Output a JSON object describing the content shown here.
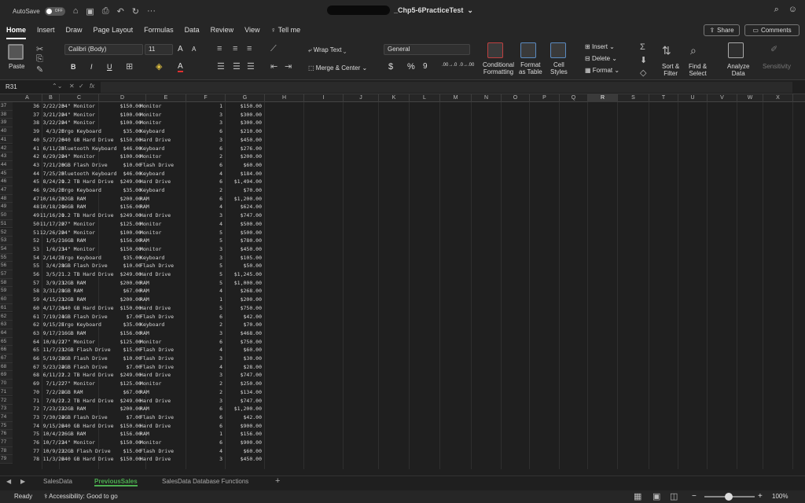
{
  "titlebar": {
    "autosave_label": "AutoSave",
    "autosave_state": "OFF",
    "doc_title": "_Chp5-6PracticeTest",
    "more_label": "···"
  },
  "menu": [
    "Home",
    "Insert",
    "Draw",
    "Page Layout",
    "Formulas",
    "Data",
    "Review",
    "View",
    "Tell me"
  ],
  "share_label": "Share",
  "comments_label": "Comments",
  "ribbon": {
    "paste": "Paste",
    "font_name": "Calibri (Body)",
    "font_size": "11",
    "bold": "B",
    "italic": "I",
    "underline": "U",
    "font_grow": "A",
    "font_shrink": "A",
    "font_color": "A",
    "wrap_text": "Wrap Text",
    "merge_center": "Merge & Center",
    "number_format": "General",
    "currency": "$",
    "percent": "%",
    "comma": "9",
    "inc_decimal": ".00→.0",
    "dec_decimal": ".0→.00",
    "conditional_formatting": "Conditional\nFormatting",
    "conditional_1": "Conditional",
    "conditional_2": "Formatting",
    "format_table_1": "Format",
    "format_table_2": "as Table",
    "cell_styles_1": "Cell",
    "cell_styles_2": "Styles",
    "insert": "Insert",
    "delete": "Delete",
    "format": "Format",
    "sort_filter_1": "Sort &",
    "sort_filter_2": "Filter",
    "find_select_1": "Find &",
    "find_select_2": "Select",
    "analyze_1": "Analyze",
    "analyze_2": "Data",
    "sensitivity": "Sensitivity"
  },
  "namebox": "R31",
  "fx": "fx",
  "columns": [
    "A",
    "B",
    "C",
    "D",
    "E",
    "F",
    "G",
    "H",
    "I",
    "J",
    "K",
    "L",
    "M",
    "N",
    "O",
    "P",
    "Q",
    "R",
    "S",
    "T",
    "U",
    "V",
    "W",
    "X"
  ],
  "selected_column": "R",
  "rows": [
    {
      "n": "37",
      "a": "36",
      "b": "2/22/20",
      "c": "34\" Monitor",
      "d": "$150.00",
      "e": "Monitor",
      "f": "1",
      "g": "$150.00"
    },
    {
      "n": "38",
      "a": "37",
      "b": "3/21/20",
      "c": "24\" Monitor",
      "d": "$100.00",
      "e": "Monitor",
      "f": "3",
      "g": "$300.00"
    },
    {
      "n": "39",
      "a": "38",
      "b": "3/22/20",
      "c": "24\" Monitor",
      "d": "$100.00",
      "e": "Monitor",
      "f": "3",
      "g": "$300.00"
    },
    {
      "n": "40",
      "a": "39",
      "b": "4/3/20",
      "c": "Ergo Keyboard",
      "d": "$35.00",
      "e": "Keyboard",
      "f": "6",
      "g": "$210.00"
    },
    {
      "n": "41",
      "a": "40",
      "b": "5/27/20",
      "c": "640 GB Hard Drive",
      "d": "$150.00",
      "e": "Hard Drive",
      "f": "3",
      "g": "$450.00"
    },
    {
      "n": "42",
      "a": "41",
      "b": "6/11/20",
      "c": "Bluetooth Keyboard",
      "d": "$46.00",
      "e": "Keyboard",
      "f": "6",
      "g": "$276.00"
    },
    {
      "n": "43",
      "a": "42",
      "b": "6/29/20",
      "c": "24\" Monitor",
      "d": "$100.00",
      "e": "Monitor",
      "f": "2",
      "g": "$200.00"
    },
    {
      "n": "44",
      "a": "43",
      "b": "7/21/20",
      "c": "8GB Flash Drive",
      "d": "$10.00",
      "e": "Flash Drive",
      "f": "6",
      "g": "$60.00"
    },
    {
      "n": "45",
      "a": "44",
      "b": "7/25/20",
      "c": "Bluetooth Keyboard",
      "d": "$46.00",
      "e": "Keyboard",
      "f": "4",
      "g": "$184.00"
    },
    {
      "n": "46",
      "a": "45",
      "b": "8/24/20",
      "c": "1.2 TB Hard Drive",
      "d": "$249.00",
      "e": "Hard Drive",
      "f": "6",
      "g": "$1,494.00"
    },
    {
      "n": "47",
      "a": "46",
      "b": "9/26/20",
      "c": "Ergo Keyboard",
      "d": "$35.00",
      "e": "Keyboard",
      "f": "2",
      "g": "$70.00"
    },
    {
      "n": "48",
      "a": "47",
      "b": "10/16/20",
      "c": "32GB RAM",
      "d": "$200.00",
      "e": "RAM",
      "f": "6",
      "g": "$1,200.00"
    },
    {
      "n": "49",
      "a": "48",
      "b": "10/18/20",
      "c": "16GB RAM",
      "d": "$156.00",
      "e": "RAM",
      "f": "4",
      "g": "$624.00"
    },
    {
      "n": "50",
      "a": "49",
      "b": "11/16/20",
      "c": "1.2 TB Hard Drive",
      "d": "$249.00",
      "e": "Hard Drive",
      "f": "3",
      "g": "$747.00"
    },
    {
      "n": "51",
      "a": "50",
      "b": "11/17/20",
      "c": "27\" Monitor",
      "d": "$125.00",
      "e": "Monitor",
      "f": "4",
      "g": "$500.00"
    },
    {
      "n": "52",
      "a": "51",
      "b": "12/26/20",
      "c": "24\" Monitor",
      "d": "$100.00",
      "e": "Monitor",
      "f": "5",
      "g": "$500.00"
    },
    {
      "n": "53",
      "a": "52",
      "b": "1/5/21",
      "c": "16GB RAM",
      "d": "$156.00",
      "e": "RAM",
      "f": "5",
      "g": "$780.00"
    },
    {
      "n": "54",
      "a": "53",
      "b": "1/6/21",
      "c": "34\" Monitor",
      "d": "$150.00",
      "e": "Monitor",
      "f": "3",
      "g": "$450.00"
    },
    {
      "n": "55",
      "a": "54",
      "b": "2/14/21",
      "c": "Ergo Keyboard",
      "d": "$35.00",
      "e": "Keyboard",
      "f": "3",
      "g": "$105.00"
    },
    {
      "n": "56",
      "a": "55",
      "b": "3/4/21",
      "c": "8GB Flash Drive",
      "d": "$10.00",
      "e": "Flash Drive",
      "f": "5",
      "g": "$50.00"
    },
    {
      "n": "57",
      "a": "56",
      "b": "3/5/21",
      "c": "1.2 TB Hard Drive",
      "d": "$249.00",
      "e": "Hard Drive",
      "f": "5",
      "g": "$1,245.00"
    },
    {
      "n": "58",
      "a": "57",
      "b": "3/9/21",
      "c": "32GB RAM",
      "d": "$200.00",
      "e": "RAM",
      "f": "5",
      "g": "$1,000.00"
    },
    {
      "n": "59",
      "a": "58",
      "b": "3/31/21",
      "c": "8GB RAM",
      "d": "$67.00",
      "e": "RAM",
      "f": "4",
      "g": "$268.00"
    },
    {
      "n": "60",
      "a": "59",
      "b": "4/15/21",
      "c": "32GB RAM",
      "d": "$200.00",
      "e": "RAM",
      "f": "1",
      "g": "$200.00"
    },
    {
      "n": "61",
      "a": "60",
      "b": "4/17/21",
      "c": "640 GB Hard Drive",
      "d": "$150.00",
      "e": "Hard Drive",
      "f": "5",
      "g": "$750.00"
    },
    {
      "n": "62",
      "a": "61",
      "b": "7/19/21",
      "c": "4GB Flash Drive",
      "d": "$7.00",
      "e": "Flash Drive",
      "f": "6",
      "g": "$42.00"
    },
    {
      "n": "63",
      "a": "62",
      "b": "9/15/21",
      "c": "Ergo Keyboard",
      "d": "$35.00",
      "e": "Keyboard",
      "f": "2",
      "g": "$70.00"
    },
    {
      "n": "64",
      "a": "63",
      "b": "9/17/21",
      "c": "16GB RAM",
      "d": "$156.00",
      "e": "RAM",
      "f": "3",
      "g": "$468.00"
    },
    {
      "n": "65",
      "a": "64",
      "b": "10/8/21",
      "c": "27\" Monitor",
      "d": "$125.00",
      "e": "Monitor",
      "f": "6",
      "g": "$750.00"
    },
    {
      "n": "66",
      "a": "65",
      "b": "11/7/21",
      "c": "32GB Flash Drive",
      "d": "$15.00",
      "e": "Flash Drive",
      "f": "4",
      "g": "$60.00"
    },
    {
      "n": "67",
      "a": "66",
      "b": "5/19/22",
      "c": "8GB Flash Drive",
      "d": "$10.00",
      "e": "Flash Drive",
      "f": "3",
      "g": "$30.00"
    },
    {
      "n": "68",
      "a": "67",
      "b": "5/23/22",
      "c": "4GB Flash Drive",
      "d": "$7.00",
      "e": "Flash Drive",
      "f": "4",
      "g": "$28.00"
    },
    {
      "n": "69",
      "a": "68",
      "b": "6/11/22",
      "c": "1.2 TB Hard Drive",
      "d": "$249.00",
      "e": "Hard Drive",
      "f": "3",
      "g": "$747.00"
    },
    {
      "n": "70",
      "a": "69",
      "b": "7/1/22",
      "c": "27\" Monitor",
      "d": "$125.00",
      "e": "Monitor",
      "f": "2",
      "g": "$250.00"
    },
    {
      "n": "71",
      "a": "70",
      "b": "7/2/22",
      "c": "8GB RAM",
      "d": "$67.00",
      "e": "RAM",
      "f": "2",
      "g": "$134.00"
    },
    {
      "n": "72",
      "a": "71",
      "b": "7/8/22",
      "c": "1.2 TB Hard Drive",
      "d": "$249.00",
      "e": "Hard Drive",
      "f": "3",
      "g": "$747.00"
    },
    {
      "n": "73",
      "a": "72",
      "b": "7/23/22",
      "c": "32GB RAM",
      "d": "$200.00",
      "e": "RAM",
      "f": "6",
      "g": "$1,200.00"
    },
    {
      "n": "74",
      "a": "73",
      "b": "7/30/22",
      "c": "4GB Flash Drive",
      "d": "$7.00",
      "e": "Flash Drive",
      "f": "6",
      "g": "$42.00"
    },
    {
      "n": "75",
      "a": "74",
      "b": "9/15/22",
      "c": "640 GB Hard Drive",
      "d": "$150.00",
      "e": "Hard Drive",
      "f": "6",
      "g": "$900.00"
    },
    {
      "n": "76",
      "a": "75",
      "b": "10/4/22",
      "c": "16GB RAM",
      "d": "$156.00",
      "e": "RAM",
      "f": "1",
      "g": "$156.00"
    },
    {
      "n": "77",
      "a": "76",
      "b": "10/7/22",
      "c": "34\" Monitor",
      "d": "$150.00",
      "e": "Monitor",
      "f": "6",
      "g": "$900.00"
    },
    {
      "n": "78",
      "a": "77",
      "b": "10/9/22",
      "c": "32GB Flash Drive",
      "d": "$15.00",
      "e": "Flash Drive",
      "f": "4",
      "g": "$60.00"
    },
    {
      "n": "79",
      "a": "78",
      "b": "11/3/22",
      "c": "640 GB Hard Drive",
      "d": "$150.00",
      "e": "Hard Drive",
      "f": "3",
      "g": "$450.00"
    }
  ],
  "sheets": [
    "SalesData",
    "PreviousSales",
    "SalesData Database Functions"
  ],
  "active_sheet": "PreviousSales",
  "add_sheet": "+",
  "status": {
    "ready": "Ready",
    "accessibility": "Accessibility: Good to go",
    "zoom": "100%",
    "zoom_level": 1.0
  }
}
